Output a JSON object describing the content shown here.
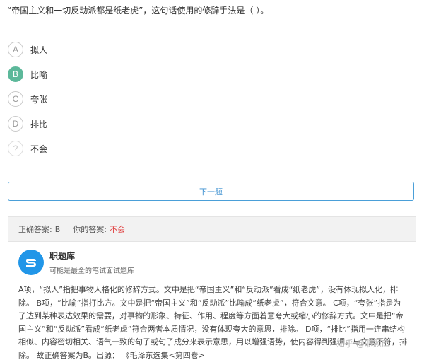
{
  "question": "“帝国主义和一切反动派都是纸老虎”，这句话使用的修辞手法是（ ）。",
  "options": [
    {
      "letter": "A",
      "text": "拟人"
    },
    {
      "letter": "B",
      "text": "比喻"
    },
    {
      "letter": "C",
      "text": "夸张"
    },
    {
      "letter": "D",
      "text": "排比"
    },
    {
      "letter": "?",
      "text": "不会"
    }
  ],
  "selected_option": "B",
  "next_button": "下一题",
  "answer": {
    "correct_label": "正确答案:",
    "correct_value": "B",
    "yours_label": "你的答案:",
    "yours_value": "不会"
  },
  "source": {
    "name": "职题库",
    "tagline": "可能是最全的笔试面试题库"
  },
  "explanation": "A项，“拟人”指把事物人格化的修辞方式。文中是把“帝国主义”和“反动派”看成“纸老虎”，没有体现拟人化，排除。 B项，“比喻”指打比方。文中是把“帝国主义”和“反动派”比喻成“纸老虎”，符合文意。 C项，“夸张”指是为了达到某种表达效果的需要，对事物的形象、特征、作用、程度等方面着意夸大或缩小的修辞方式。文中是把“帝国主义”和“反动派”看成“纸老虎”符合两者本质情况，没有体现夸大的意思，排除。 D项，“排比”指用一连串结构相似、内容密切相关、语气一致的句子或句子成分来表示意思，用以增强语势，使内容得到强调。与文意不符，排除。 故正确答案为B。出源： 《毛泽东选集<第四卷>",
  "watermark": "知乎 @职题库",
  "colors": {
    "selected": "#5cb89a",
    "button_border": "#4a9fd8",
    "wrong": "#e03c3c",
    "logo": "#2196e8"
  }
}
